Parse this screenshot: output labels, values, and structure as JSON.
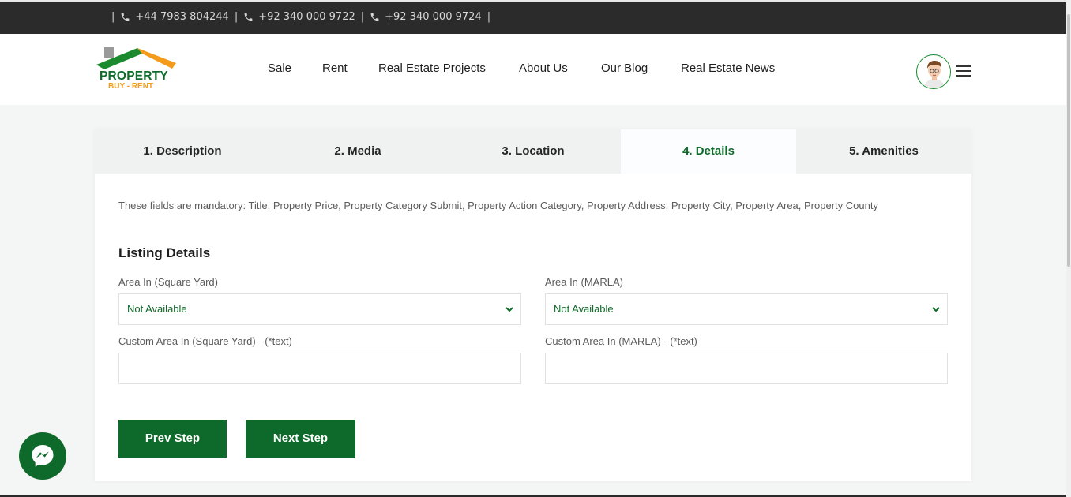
{
  "topbar": {
    "separator": "|",
    "phones": [
      "+44 7983 804244",
      "+92 340 000 9722",
      "+92 340 000 9724"
    ]
  },
  "logo": {
    "line1": "PROPERTY",
    "line2": "BUY - RENT"
  },
  "nav": {
    "items": [
      "Sale",
      "Rent",
      "Real Estate Projects",
      "About Us",
      "Our Blog",
      "Real Estate News"
    ]
  },
  "tabs": [
    {
      "label": "1. Description",
      "active": false
    },
    {
      "label": "2. Media",
      "active": false
    },
    {
      "label": "3. Location",
      "active": false
    },
    {
      "label": "4. Details",
      "active": true
    },
    {
      "label": "5. Amenities",
      "active": false
    }
  ],
  "form": {
    "notice": "These fields are mandatory: Title, Property Price, Property Category Submit, Property Action Category, Property Address, Property City, Property Area, Property County",
    "section_title": "Listing Details",
    "area_sq_yard_label": "Area In (Square Yard)",
    "area_sq_yard_value": "Not Available",
    "area_marla_label": "Area In (MARLA)",
    "area_marla_value": "Not Available",
    "custom_sq_yard_label": "Custom Area In (Square Yard) - (*text)",
    "custom_sq_yard_value": "",
    "custom_marla_label": "Custom Area In (MARLA) - (*text)",
    "custom_marla_value": "",
    "prev_label": "Prev Step",
    "next_label": "Next Step"
  },
  "icons": {
    "phone": "phone-icon",
    "menu": "hamburger-menu-icon",
    "avatar": "user-avatar",
    "messenger": "messenger-icon",
    "select_arrow": "chevron-down-icon"
  },
  "colors": {
    "brand_green": "#0e6a2b",
    "brand_orange": "#f59b1b",
    "topbar": "#2b2b2b",
    "tab_bar": "#f0f1f1"
  }
}
